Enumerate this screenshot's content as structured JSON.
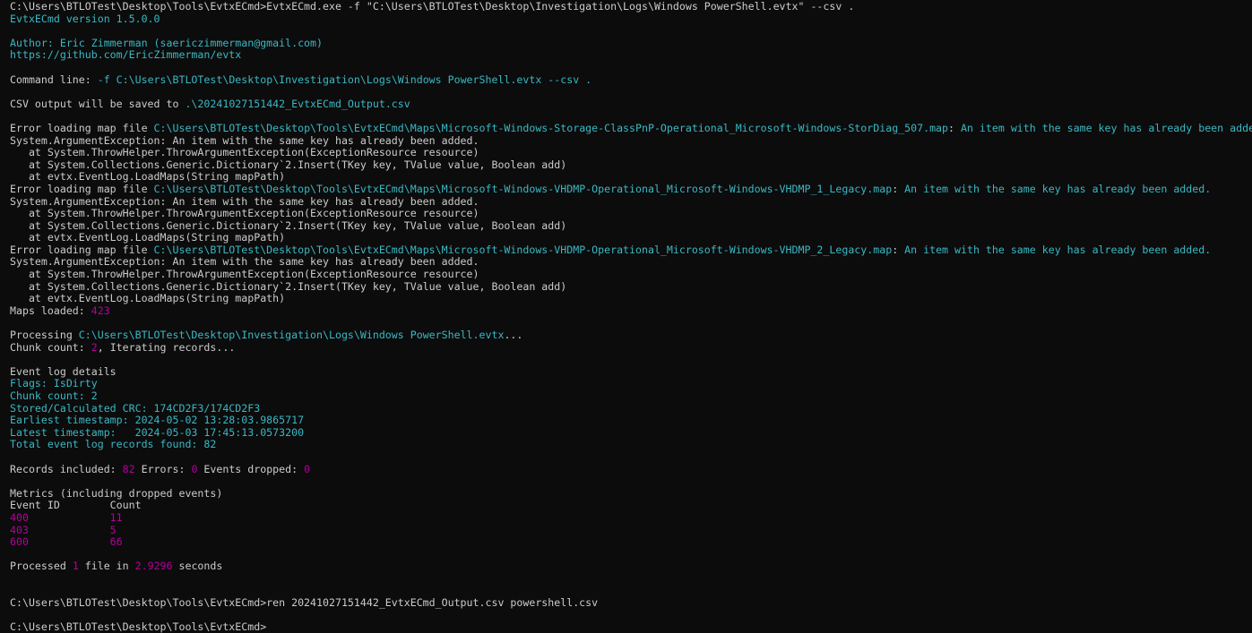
{
  "colors": {
    "background": "#0c0c0c",
    "default_text": "#cccccc",
    "cyan": "#3ab8c4",
    "magenta": "#b4009e"
  },
  "lines": [
    [
      {
        "t": "C:\\Users\\BTLOTest\\Desktop\\Tools\\EvtxECmd>EvtxECmd.exe -f \"C:\\Users\\BTLOTest\\Desktop\\Investigation\\Logs\\Windows PowerShell.evtx\" --csv .",
        "c": "w"
      }
    ],
    [
      {
        "t": "EvtxECmd version 1.5.0.0",
        "c": "c"
      }
    ],
    [],
    [
      {
        "t": "Author: Eric Zimmerman (saericzimmerman@gmail.com)",
        "c": "c"
      }
    ],
    [
      {
        "t": "https://github.com/EricZimmerman/evtx",
        "c": "c"
      }
    ],
    [],
    [
      {
        "t": "Command line: ",
        "c": "w"
      },
      {
        "t": "-f C:\\Users\\BTLOTest\\Desktop\\Investigation\\Logs\\Windows PowerShell.evtx --csv .",
        "c": "c"
      }
    ],
    [],
    [
      {
        "t": "CSV output will be saved to ",
        "c": "w"
      },
      {
        "t": ".\\20241027151442_EvtxECmd_Output.csv",
        "c": "c"
      }
    ],
    [],
    [
      {
        "t": "Error loading map file ",
        "c": "w"
      },
      {
        "t": "C:\\Users\\BTLOTest\\Desktop\\Tools\\EvtxECmd\\Maps\\Microsoft-Windows-Storage-ClassPnP-Operational_Microsoft-Windows-StorDiag_507.map",
        "c": "c"
      },
      {
        "t": ": ",
        "c": "w"
      },
      {
        "t": "An item with the same key has already been added.",
        "c": "c"
      }
    ],
    [
      {
        "t": "System.ArgumentException: An item with the same key has already been added.",
        "c": "w"
      }
    ],
    [
      {
        "t": "   at System.ThrowHelper.ThrowArgumentException(ExceptionResource resource)",
        "c": "w"
      }
    ],
    [
      {
        "t": "   at System.Collections.Generic.Dictionary`2.Insert(TKey key, TValue value, Boolean add)",
        "c": "w"
      }
    ],
    [
      {
        "t": "   at evtx.EventLog.LoadMaps(String mapPath)",
        "c": "w"
      }
    ],
    [
      {
        "t": "Error loading map file ",
        "c": "w"
      },
      {
        "t": "C:\\Users\\BTLOTest\\Desktop\\Tools\\EvtxECmd\\Maps\\Microsoft-Windows-VHDMP-Operational_Microsoft-Windows-VHDMP_1_Legacy.map",
        "c": "c"
      },
      {
        "t": ": ",
        "c": "w"
      },
      {
        "t": "An item with the same key has already been added.",
        "c": "c"
      }
    ],
    [
      {
        "t": "System.ArgumentException: An item with the same key has already been added.",
        "c": "w"
      }
    ],
    [
      {
        "t": "   at System.ThrowHelper.ThrowArgumentException(ExceptionResource resource)",
        "c": "w"
      }
    ],
    [
      {
        "t": "   at System.Collections.Generic.Dictionary`2.Insert(TKey key, TValue value, Boolean add)",
        "c": "w"
      }
    ],
    [
      {
        "t": "   at evtx.EventLog.LoadMaps(String mapPath)",
        "c": "w"
      }
    ],
    [
      {
        "t": "Error loading map file ",
        "c": "w"
      },
      {
        "t": "C:\\Users\\BTLOTest\\Desktop\\Tools\\EvtxECmd\\Maps\\Microsoft-Windows-VHDMP-Operational_Microsoft-Windows-VHDMP_2_Legacy.map",
        "c": "c"
      },
      {
        "t": ": ",
        "c": "w"
      },
      {
        "t": "An item with the same key has already been added.",
        "c": "c"
      }
    ],
    [
      {
        "t": "System.ArgumentException: An item with the same key has already been added.",
        "c": "w"
      }
    ],
    [
      {
        "t": "   at System.ThrowHelper.ThrowArgumentException(ExceptionResource resource)",
        "c": "w"
      }
    ],
    [
      {
        "t": "   at System.Collections.Generic.Dictionary`2.Insert(TKey key, TValue value, Boolean add)",
        "c": "w"
      }
    ],
    [
      {
        "t": "   at evtx.EventLog.LoadMaps(String mapPath)",
        "c": "w"
      }
    ],
    [
      {
        "t": "Maps loaded: ",
        "c": "w"
      },
      {
        "t": "423",
        "c": "m"
      }
    ],
    [],
    [
      {
        "t": "Processing ",
        "c": "w"
      },
      {
        "t": "C:\\Users\\BTLOTest\\Desktop\\Investigation\\Logs\\Windows PowerShell.evtx",
        "c": "c"
      },
      {
        "t": "...",
        "c": "w"
      }
    ],
    [
      {
        "t": "Chunk count: ",
        "c": "w"
      },
      {
        "t": "2",
        "c": "m"
      },
      {
        "t": ", Iterating records...",
        "c": "w"
      }
    ],
    [],
    [
      {
        "t": "Event log details",
        "c": "w"
      }
    ],
    [
      {
        "t": "Flags: IsDirty",
        "c": "c"
      }
    ],
    [
      {
        "t": "Chunk count: 2",
        "c": "c"
      }
    ],
    [
      {
        "t": "Stored/Calculated CRC: 174CD2F3/174CD2F3",
        "c": "c"
      }
    ],
    [
      {
        "t": "Earliest timestamp: 2024-05-02 13:28:03.9865717",
        "c": "c"
      }
    ],
    [
      {
        "t": "Latest timestamp:   2024-05-03 17:45:13.0573200",
        "c": "c"
      }
    ],
    [
      {
        "t": "Total event log records found: 82",
        "c": "c"
      }
    ],
    [],
    [
      {
        "t": "Records included: ",
        "c": "w"
      },
      {
        "t": "82",
        "c": "m"
      },
      {
        "t": " Errors: ",
        "c": "w"
      },
      {
        "t": "0",
        "c": "m"
      },
      {
        "t": " Events dropped: ",
        "c": "w"
      },
      {
        "t": "0",
        "c": "m"
      }
    ],
    [],
    [
      {
        "t": "Metrics (including dropped events)",
        "c": "w"
      }
    ],
    [
      {
        "t": "Event ID        Count",
        "c": "w"
      }
    ],
    [
      {
        "t": "400             11",
        "c": "m"
      }
    ],
    [
      {
        "t": "403             5",
        "c": "m"
      }
    ],
    [
      {
        "t": "600             66",
        "c": "m"
      }
    ],
    [],
    [
      {
        "t": "Processed ",
        "c": "w"
      },
      {
        "t": "1",
        "c": "m"
      },
      {
        "t": " file in ",
        "c": "w"
      },
      {
        "t": "2.9296",
        "c": "m"
      },
      {
        "t": " seconds",
        "c": "w"
      }
    ],
    [],
    [],
    [
      {
        "t": "C:\\Users\\BTLOTest\\Desktop\\Tools\\EvtxECmd>ren 20241027151442_EvtxECmd_Output.csv powershell.csv",
        "c": "w"
      }
    ],
    [],
    [
      {
        "t": "C:\\Users\\BTLOTest\\Desktop\\Tools\\EvtxECmd>",
        "c": "w"
      }
    ]
  ]
}
